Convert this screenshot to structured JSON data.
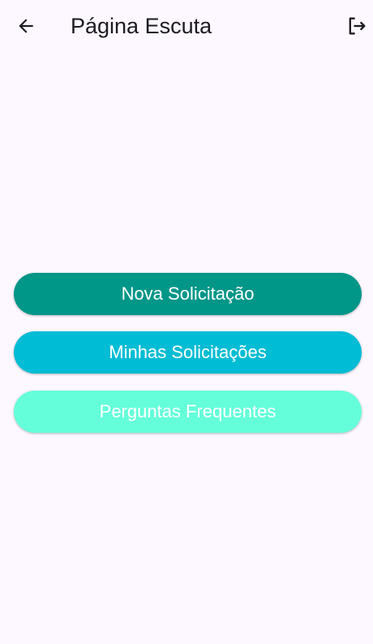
{
  "app_bar": {
    "title": "Página Escuta",
    "back_icon": "arrow-left-icon",
    "logout_icon": "logout-icon"
  },
  "buttons": [
    {
      "label": "Nova Solicitação",
      "color": "#009688"
    },
    {
      "label": "Minhas Solicitações",
      "color": "#00bcd4"
    },
    {
      "label": "Perguntas Frequentes",
      "color": "#64ffda"
    }
  ],
  "colors": {
    "background": "#fdf7ff",
    "text_primary": "#1d1b20",
    "button_text": "#ffffff"
  }
}
